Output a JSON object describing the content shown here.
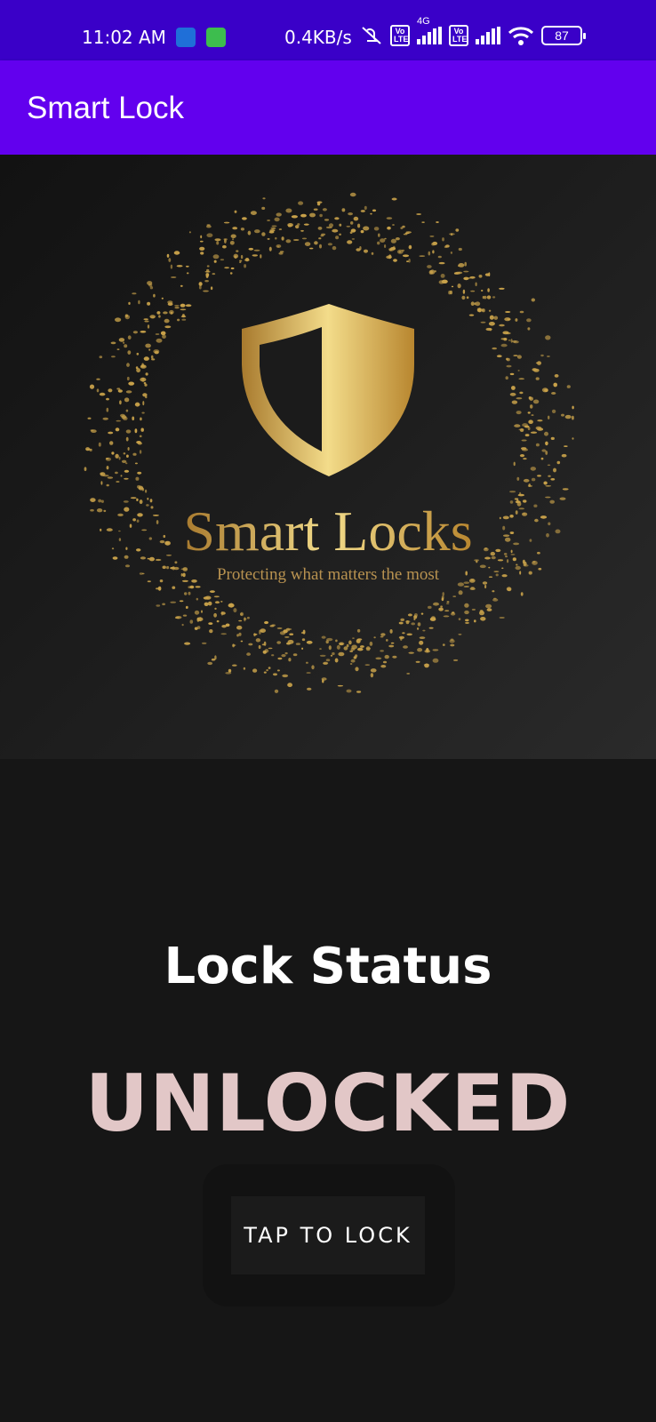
{
  "status_bar": {
    "time": "11:02 AM",
    "network_speed": "0.4KB/s",
    "battery_level": "87",
    "network_type": "4G",
    "volte_label": "Vo LTE"
  },
  "app_bar": {
    "title": "Smart Lock"
  },
  "banner": {
    "brand": "Smart Locks",
    "tagline": "Protecting what matters the most",
    "icon": "shield-icon"
  },
  "lock": {
    "label": "Lock Status",
    "state": "UNLOCKED",
    "action_label": "TAP TO LOCK"
  },
  "colors": {
    "status_bar": "#3a00c8",
    "app_bar": "#6200ee",
    "background": "#161616",
    "state_text": "#e2c7c7",
    "gold": "#c9a24a"
  }
}
